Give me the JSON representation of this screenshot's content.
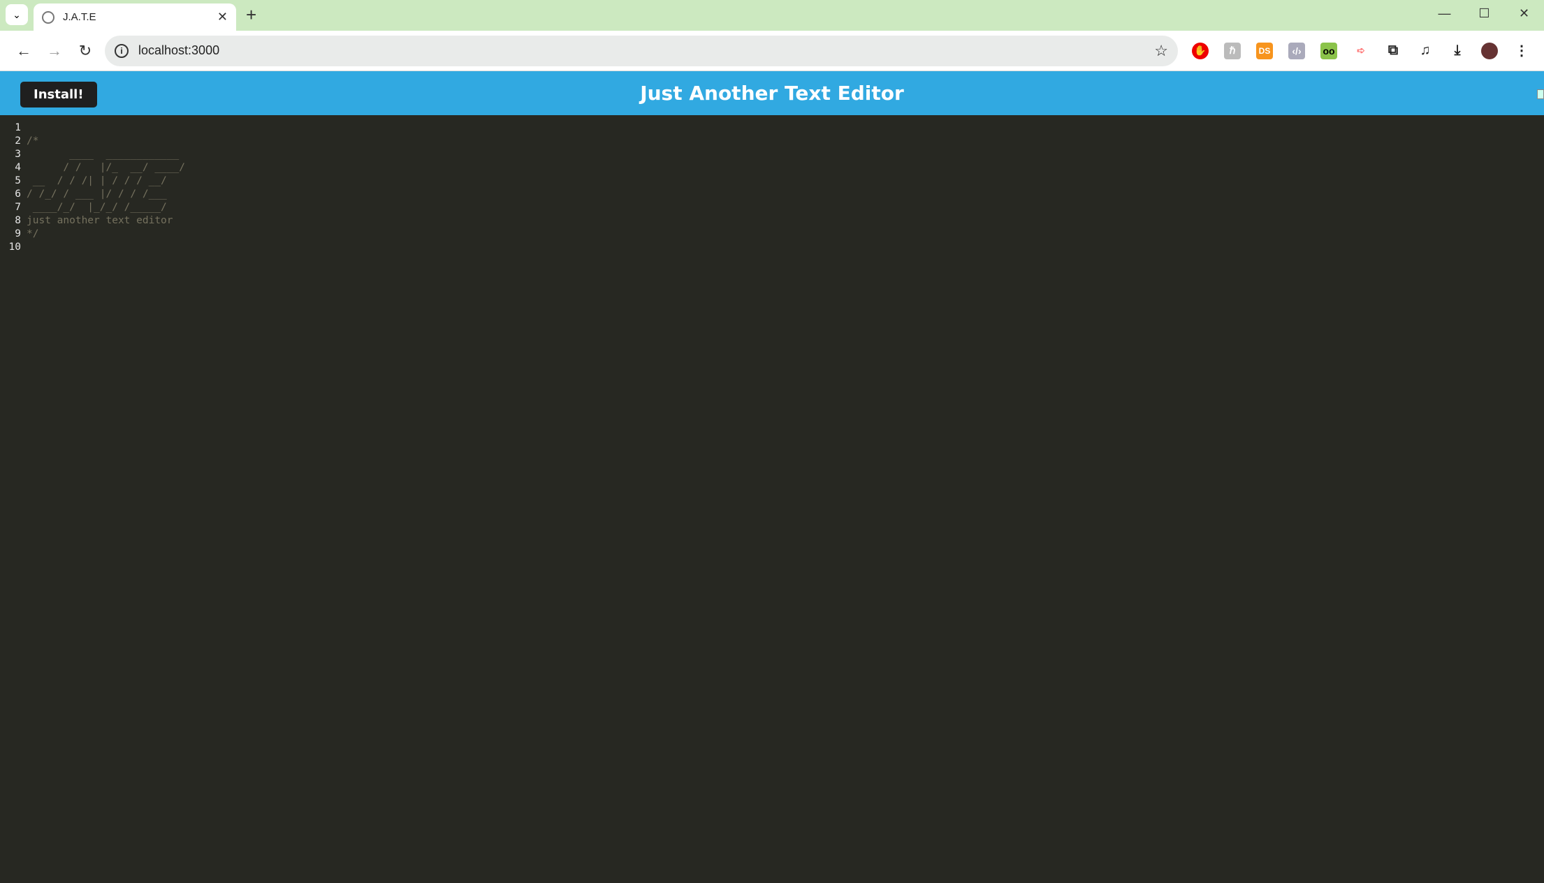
{
  "browser": {
    "tab_title": "J.A.T.E",
    "url": "localhost:3000",
    "extensions": [
      "adblock-icon",
      "h-extension-icon",
      "ds-extension-icon",
      "code-extension-icon",
      "glasses-extension-icon",
      "arrow-extension-icon",
      "puzzle-icon"
    ],
    "ds_label": "DS"
  },
  "header": {
    "install_label": "Install!",
    "title": "Just Another Text Editor",
    "accent": "#31a9e1"
  },
  "editor": {
    "lines": [
      {
        "n": "1",
        "text": ""
      },
      {
        "n": "2",
        "text": "/*"
      },
      {
        "n": "3",
        "text": "       ____  ____________"
      },
      {
        "n": "4",
        "text": "      / /   |/_  __/ ____/"
      },
      {
        "n": "5",
        "text": " __  / / /| | / / / __/"
      },
      {
        "n": "6",
        "text": "/ /_/ / ___ |/ / / /___"
      },
      {
        "n": "7",
        "text": " ____/_/  |_/_/ /_____/"
      },
      {
        "n": "8",
        "text": "just another text editor"
      },
      {
        "n": "9",
        "text": "*/"
      },
      {
        "n": "10",
        "text": ""
      }
    ]
  }
}
